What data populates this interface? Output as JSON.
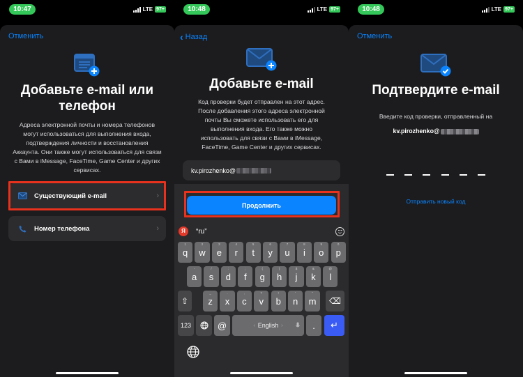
{
  "screens": [
    {
      "status": {
        "time": "10:47",
        "network": "LTE",
        "battery": "97+"
      },
      "nav": {
        "left_label": "Отменить"
      },
      "icon": "form-add-icon",
      "title": "Добавьте e-mail или телефон",
      "description": "Адреса электронной почты и номера телефонов могут использоваться для выполнения входа, подтверждения личности и восстановления Аккаунта. Они также могут использоваться для связи с Вами в iMessage, FaceTime, Game Center и других сервисах.",
      "options": [
        {
          "label": "Существующий e-mail",
          "icon": "envelope-icon",
          "highlighted": true
        },
        {
          "label": "Номер телефона",
          "icon": "phone-icon",
          "highlighted": false
        }
      ]
    },
    {
      "status": {
        "time": "10:48",
        "network": "LTE",
        "battery": "97+"
      },
      "nav": {
        "left_label": "Назад"
      },
      "icon": "envelope-add-icon",
      "title": "Добавьте e-mail",
      "description": "Код проверки будет отправлен на этот адрес. После добавления этого адреса электронной почты Вы сможете использовать его для выполнения входа. Его также можно использовать для связи с Вами в iMessage, FaceTime, Game Center и других сервисах.",
      "email_value": "kv.pirozhenko@",
      "continue_label": "Продолжить",
      "keyboard": {
        "suggestion": "“ru”",
        "suggestion_app_icon": "Я",
        "rows": [
          [
            {
              "k": "q",
              "h": "1"
            },
            {
              "k": "w",
              "h": "2"
            },
            {
              "k": "e",
              "h": "3"
            },
            {
              "k": "r",
              "h": "4"
            },
            {
              "k": "t",
              "h": "5"
            },
            {
              "k": "y",
              "h": "6"
            },
            {
              "k": "u",
              "h": "7"
            },
            {
              "k": "i",
              "h": "8"
            },
            {
              "k": "o",
              "h": "9"
            },
            {
              "k": "p",
              "h": "0"
            }
          ],
          [
            {
              "k": "a",
              "h": "-"
            },
            {
              "k": "s",
              "h": "/"
            },
            {
              "k": "d",
              "h": ":"
            },
            {
              "k": "f",
              "h": ";"
            },
            {
              "k": "g",
              "h": "("
            },
            {
              "k": "h",
              "h": ")"
            },
            {
              "k": "j",
              "h": "$"
            },
            {
              "k": "k",
              "h": "&"
            },
            {
              "k": "l",
              "h": "@"
            }
          ],
          [
            {
              "k": "z",
              "h": "_"
            },
            {
              "k": "x",
              "h": "."
            },
            {
              "k": "c",
              "h": ","
            },
            {
              "k": "v",
              "h": "?"
            },
            {
              "k": "b",
              "h": "!"
            },
            {
              "k": "n",
              "h": "'"
            },
            {
              "k": "m",
              "h": "\""
            }
          ]
        ],
        "numbers_key": "123",
        "at_key": "@",
        "space_label": "English",
        "period_key": ".",
        "return_key": "↵",
        "shift_key": "⇧",
        "delete_key": "⌫"
      }
    },
    {
      "status": {
        "time": "10:48",
        "network": "LTE",
        "battery": "97+"
      },
      "nav": {
        "left_label": "Отменить"
      },
      "icon": "envelope-check-icon",
      "title": "Подтвердите e-mail",
      "instruction": "Введите код проверки, отправленный на",
      "email_value": "kv.pirozhenko@",
      "code_length": 6,
      "resend_label": "Отправить новый код"
    }
  ]
}
